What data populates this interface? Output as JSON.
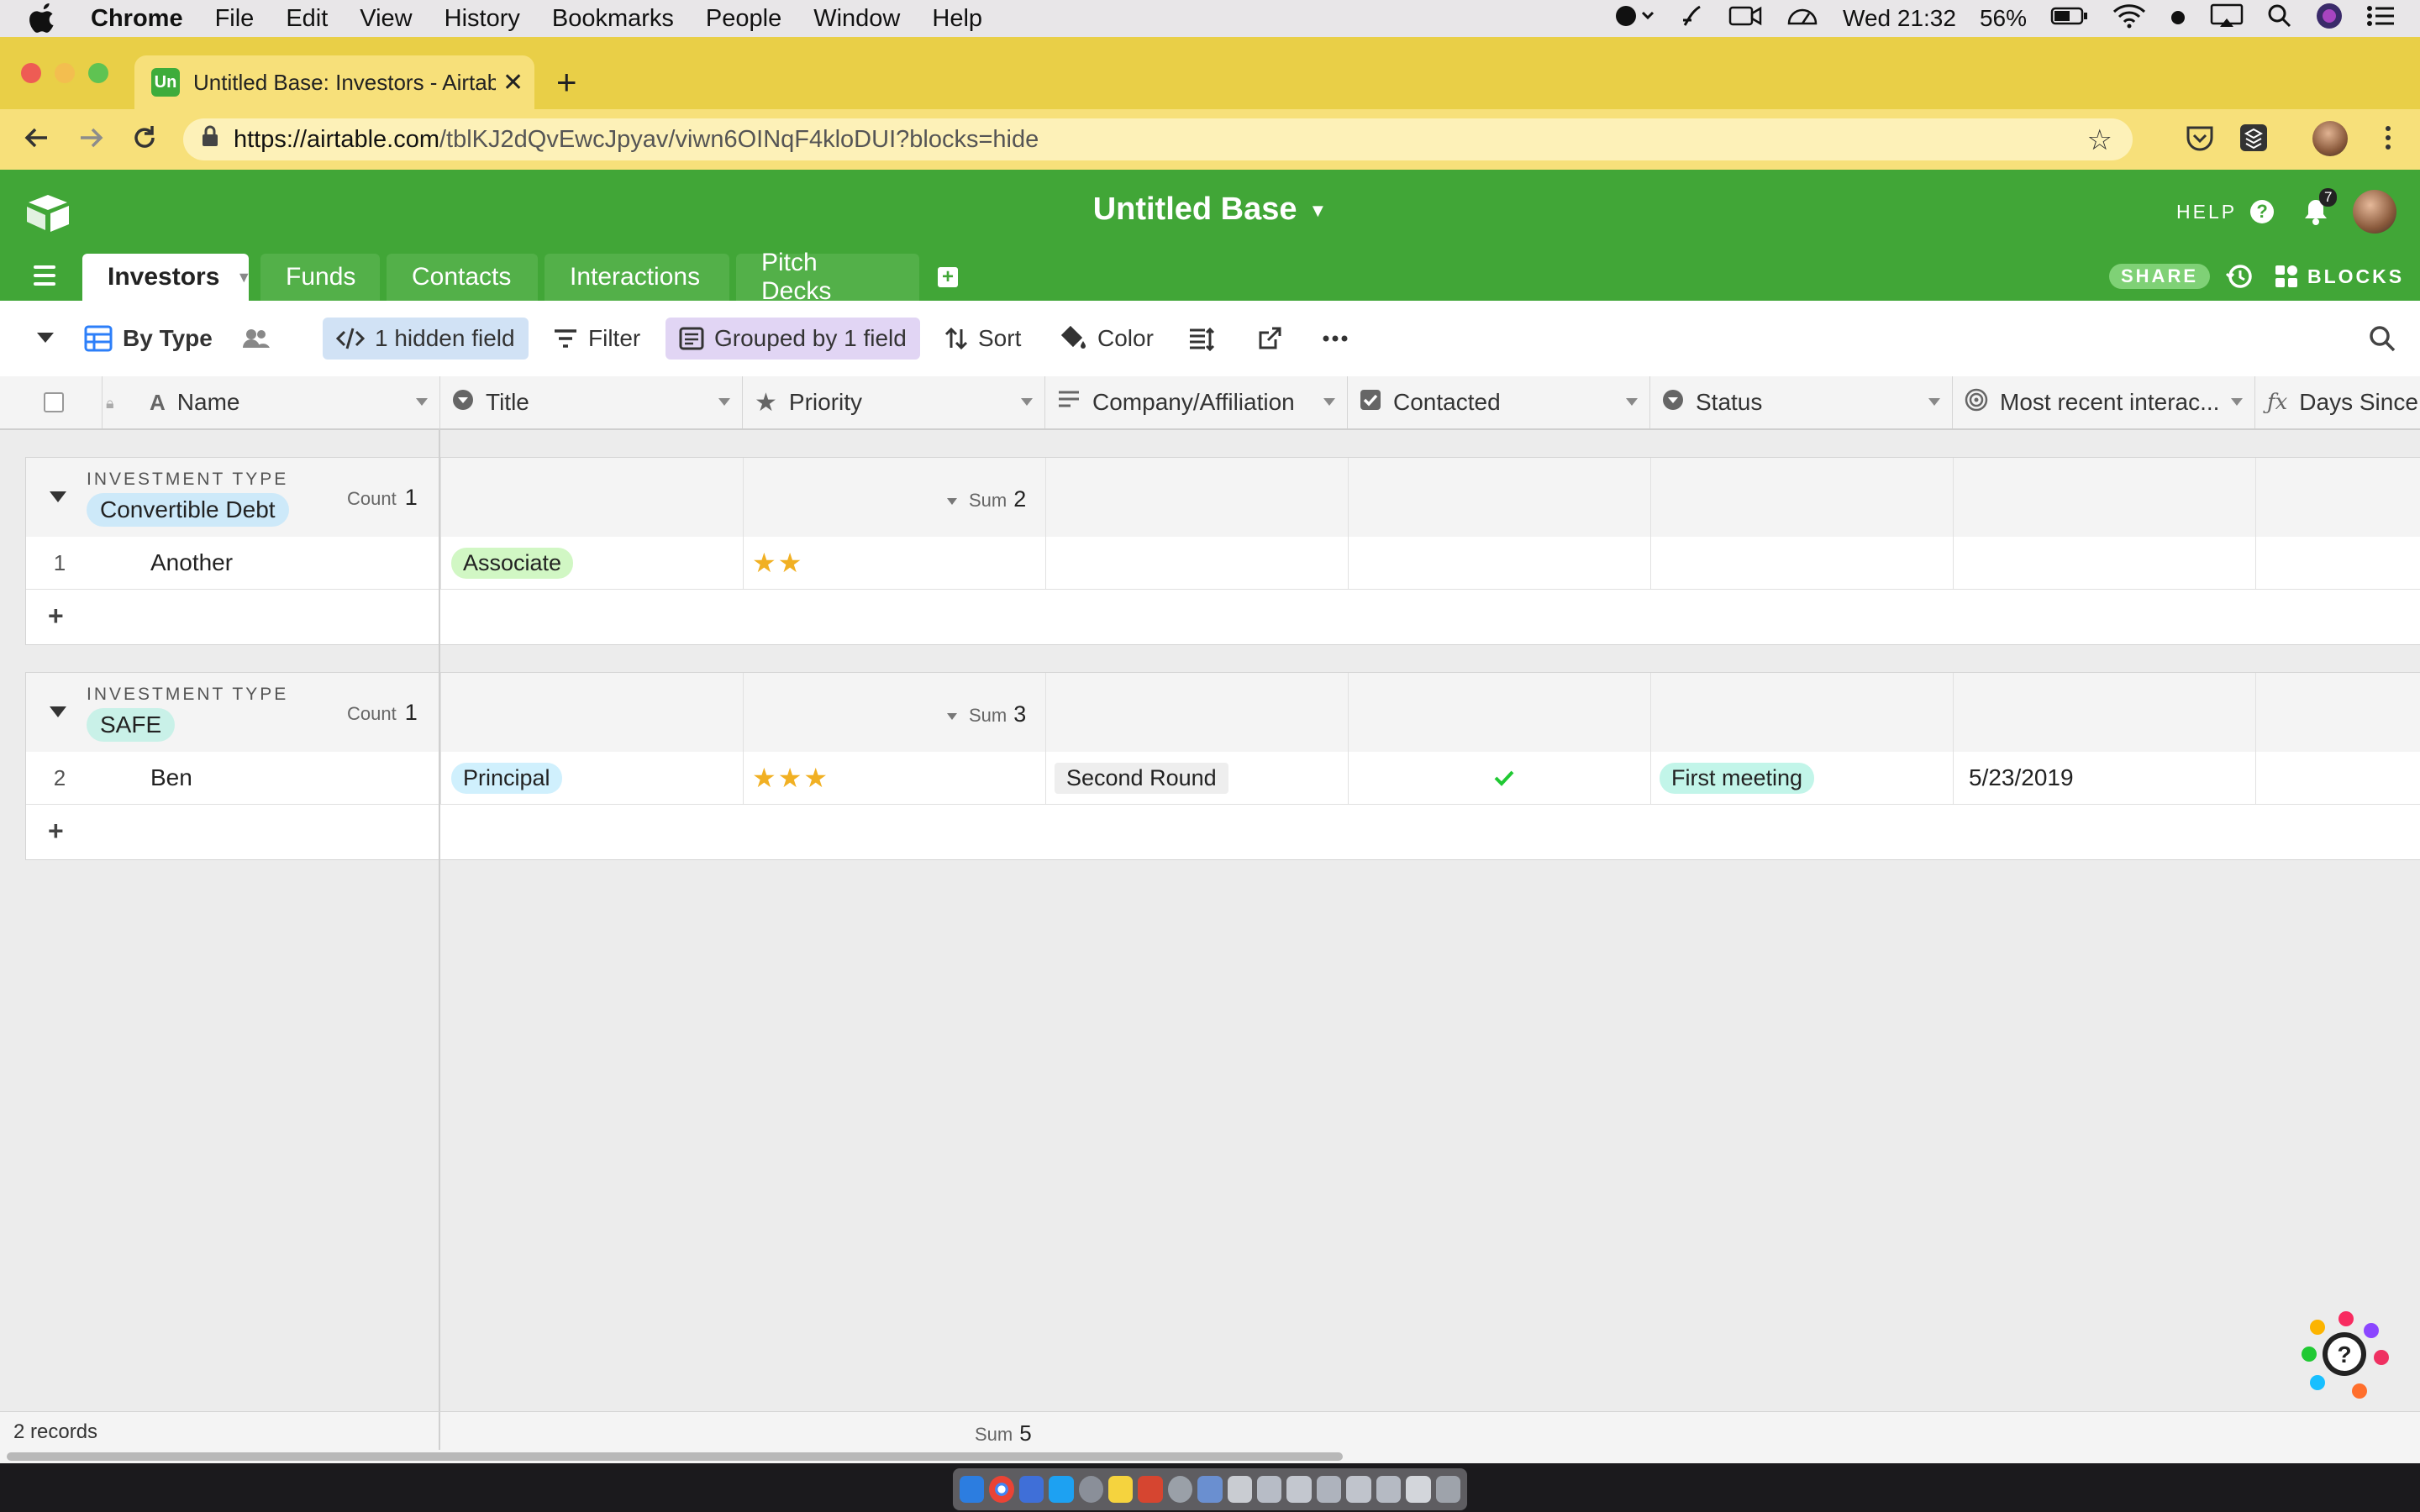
{
  "menubar": {
    "items": [
      "Chrome",
      "File",
      "Edit",
      "View",
      "History",
      "Bookmarks",
      "People",
      "Window",
      "Help"
    ],
    "clock": "Wed 21:32",
    "battery": "56%"
  },
  "browser": {
    "tab_title": "Untitled Base: Investors - Airtable",
    "favicon_text": "Un",
    "url_host": "https://airtable.com",
    "url_path": "/tblKJ2dQvEwcJpyav/viwn6OINqF4kloDUI?blocks=hide"
  },
  "airtable": {
    "base_title": "Untitled Base",
    "help_label": "HELP",
    "notification_count": "7",
    "tables": [
      "Investors",
      "Funds",
      "Contacts",
      "Interactions",
      "Pitch Decks"
    ],
    "share_label": "SHARE",
    "blocks_label": "BLOCKS",
    "brand_color": "#41a637"
  },
  "toolbar": {
    "view_name": "By Type",
    "hidden_fields": "1 hidden field",
    "filter": "Filter",
    "grouped": "Grouped by 1 field",
    "sort": "Sort",
    "color": "Color"
  },
  "columns": [
    "Name",
    "Title",
    "Priority",
    "Company/Affiliation",
    "Contacted",
    "Status",
    "Most recent interac...",
    "Days Since I"
  ],
  "groups": [
    {
      "type_label": "INVESTMENT TYPE",
      "value": "Convertible Debt",
      "count_label": "Count",
      "count": "1",
      "sum_label": "Sum",
      "sum": "2",
      "records": [
        {
          "num": "1",
          "name": "Another",
          "title": "Associate",
          "priority": 2,
          "company": "",
          "contacted": false,
          "status": "",
          "recent": ""
        }
      ]
    },
    {
      "type_label": "INVESTMENT TYPE",
      "value": "SAFE",
      "count_label": "Count",
      "count": "1",
      "sum_label": "Sum",
      "sum": "3",
      "records": [
        {
          "num": "2",
          "name": "Ben",
          "title": "Principal",
          "priority": 3,
          "company": "Second Round",
          "contacted": true,
          "status": "First meeting",
          "recent": "5/23/2019"
        }
      ]
    }
  ],
  "footer": {
    "records": "2 records",
    "sum_label": "Sum",
    "sum": "5"
  }
}
